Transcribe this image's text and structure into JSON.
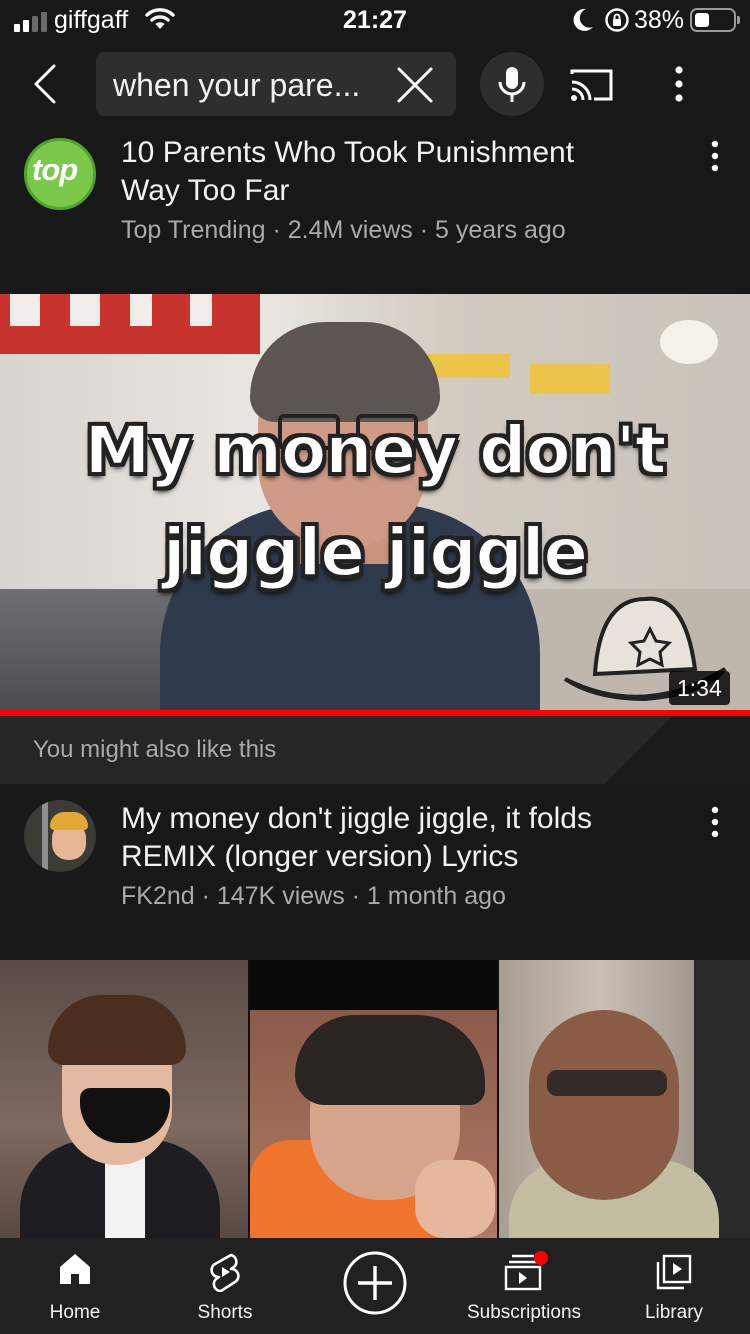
{
  "status_bar": {
    "carrier": "giffgaff",
    "time": "21:27",
    "battery_percent": "38%",
    "battery_level": 0.38,
    "signal_bars_active": 2,
    "icons": [
      "signal-icon",
      "wifi-icon",
      "moon-icon",
      "rotation-lock-icon",
      "battery-icon"
    ]
  },
  "header": {
    "back_icon": "chevron-left-icon",
    "search_query": "when your pare...",
    "clear_icon": "close-icon",
    "mic_icon": "microphone-icon",
    "cast_icon": "cast-icon",
    "more_icon": "more-vertical-icon"
  },
  "video_1": {
    "channel_logo_text": "top",
    "title_line1": "10 Parents Who Took Punishment",
    "title_line2": "Way Too Far",
    "meta": "Top Trending · 2.4M views · 5 years ago"
  },
  "featured": {
    "caption_line1": "My money don't",
    "caption_line2": "jiggle jiggle",
    "duration": "1:34",
    "watch_progress": 1.0
  },
  "suggestion": {
    "text": "You might also like this"
  },
  "video_2": {
    "title_line1": "My money don't jiggle jiggle, it folds",
    "title_line2": "REMIX (longer version) Lyrics",
    "meta": "FK2nd · 147K views · 1 month ago"
  },
  "bottom_nav": {
    "items": [
      {
        "label": "Home",
        "icon": "home-icon"
      },
      {
        "label": "Shorts",
        "icon": "shorts-icon"
      },
      {
        "label": "",
        "icon": "create-plus-icon"
      },
      {
        "label": "Subscriptions",
        "icon": "subscriptions-icon"
      },
      {
        "label": "Library",
        "icon": "library-icon"
      }
    ]
  },
  "colors": {
    "background": "#0f0f0f",
    "surface": "#181818",
    "accent_red": "#ff0000",
    "text_secondary": "#aaaaaa"
  }
}
